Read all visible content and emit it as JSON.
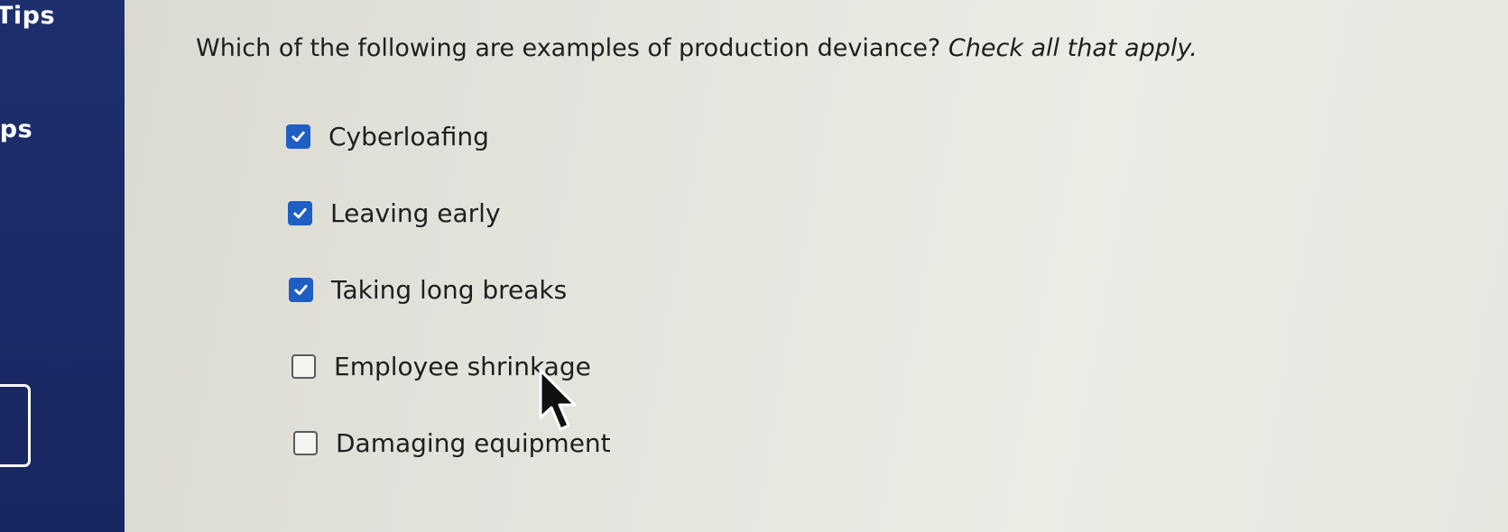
{
  "sidebar": {
    "label_top": "Tips",
    "label_mid": "ips"
  },
  "question": {
    "text": "Which of the following are examples of production deviance?",
    "instruction": "Check all that apply."
  },
  "options": [
    {
      "label": "Cyberloafing",
      "checked": true
    },
    {
      "label": "Leaving early",
      "checked": true
    },
    {
      "label": "Taking long breaks",
      "checked": true
    },
    {
      "label": "Employee shrinkage",
      "checked": false
    },
    {
      "label": "Damaging equipment",
      "checked": false
    }
  ],
  "colors": {
    "sidebar": "#1e2f6e",
    "checkbox_checked": "#1f5fc4",
    "text": "#1f1f1f"
  }
}
